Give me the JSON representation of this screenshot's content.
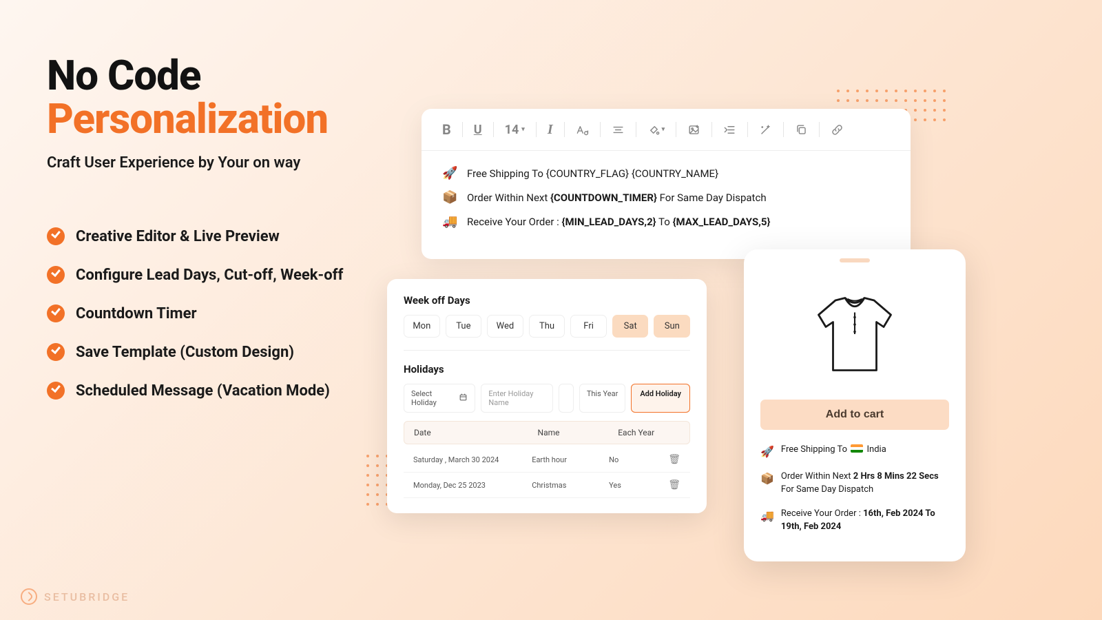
{
  "hero": {
    "title_line1": "No Code",
    "title_line2": "Personalization",
    "subtitle": "Craft User Experience by Your on way"
  },
  "features": [
    "Creative Editor & Live Preview",
    "Configure Lead Days, Cut-off, Week-off",
    "Countdown Timer",
    "Save Template (Custom Design)",
    "Scheduled Message (Vacation Mode)"
  ],
  "toolbar": {
    "fontsize": "14"
  },
  "editor_lines": {
    "l1_prefix": "Free Shipping To ",
    "l1_tag": "{COUNTRY_FLAG} {COUNTRY_NAME}",
    "l2_prefix": "Order Within Next ",
    "l2_tag": "{COUNTDOWN_TIMER}",
    "l2_suffix": " For Same Day Dispatch",
    "l3_prefix": "Receive Your Order :  ",
    "l3_tag1": "{MIN_LEAD_DAYS,2}",
    "l3_mid": " To  ",
    "l3_tag2": "{MAX_LEAD_DAYS,5}"
  },
  "weekoff": {
    "title": "Week off Days",
    "days": [
      "Mon",
      "Tue",
      "Wed",
      "Thu",
      "Fri",
      "Sat",
      "Sun"
    ],
    "selected": [
      "Sat",
      "Sun"
    ]
  },
  "holidays": {
    "title": "Holidays",
    "select_placeholder": "Select Holiday",
    "name_placeholder": "Enter Holiday Name",
    "year_label": "This Year",
    "add_button": "Add Holiday",
    "columns": [
      "Date",
      "Name",
      "Each Year"
    ],
    "rows": [
      {
        "date": "Saturday , March 30 2024",
        "name": "Earth hour",
        "each": "No"
      },
      {
        "date": "Monday, Dec  25  2023",
        "name": "Christmas",
        "each": "Yes"
      }
    ]
  },
  "phone": {
    "add_to_cart": "Add to cart",
    "promo1_prefix": "Free Shipping To ",
    "promo1_country": " India",
    "promo2_prefix": "Order Within Next ",
    "promo2_timer": "2 Hrs 8 Mins 22 Secs",
    "promo2_suffix": " For Same Day Dispatch",
    "promo3_prefix": "Receive Your Order :  ",
    "promo3_range": "16th, Feb 2024 To 19th, Feb 2024"
  },
  "brand": "SETUBRIDGE"
}
